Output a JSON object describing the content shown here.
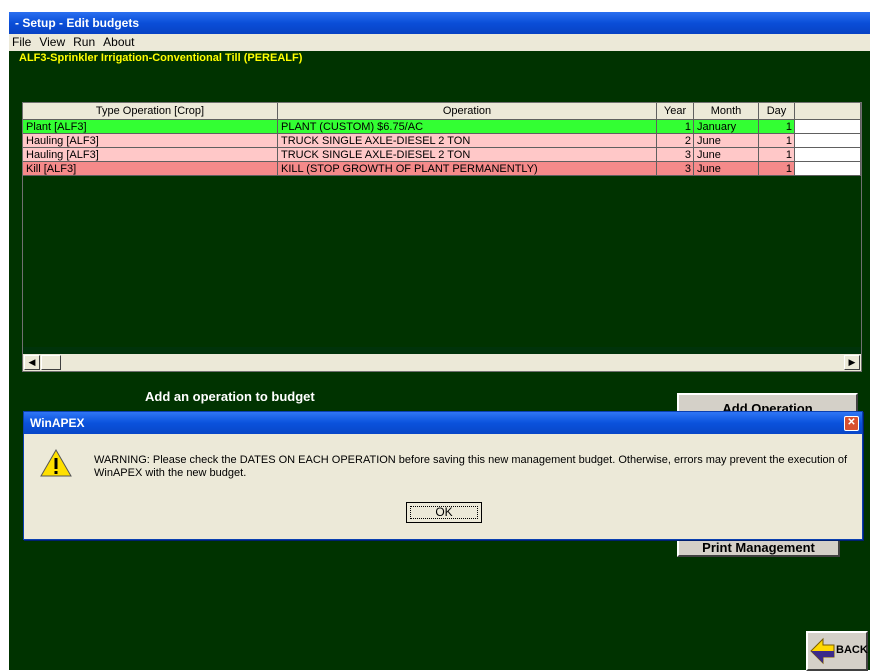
{
  "window": {
    "title": "- Setup - Edit budgets"
  },
  "menu": [
    "File",
    "View",
    "Run",
    "About"
  ],
  "subtitle": "ALF3-Sprinkler Irrigation-Conventional Till  (PEREALF)",
  "table": {
    "columns": [
      "Type Operation [Crop]",
      "Operation",
      "Year",
      "Month",
      "Day"
    ],
    "rows": [
      {
        "type": "Plant [ALF3]",
        "operation": "PLANT (CUSTOM) $6.75/AC",
        "year": "1",
        "month": "January",
        "day": "1",
        "color": "#33ff33"
      },
      {
        "type": "Hauling [ALF3]",
        "operation": "TRUCK SINGLE AXLE-DIESEL 2 TON",
        "year": "2",
        "month": "June",
        "day": "1",
        "color": "#ffc8c8"
      },
      {
        "type": "Hauling [ALF3]",
        "operation": "TRUCK SINGLE AXLE-DIESEL 2 TON",
        "year": "3",
        "month": "June",
        "day": "1",
        "color": "#ffc8c8"
      },
      {
        "type": "Kill [ALF3]",
        "operation": "KILL (STOP GROWTH OF PLANT PERMANENTLY)",
        "year": "3",
        "month": "June",
        "day": "1",
        "color": "#f58a8a"
      }
    ]
  },
  "add_label": "Add an operation to budget",
  "buttons": {
    "add_operation": "Add  Operation",
    "print_management": "Print Management",
    "back": "BACK"
  },
  "dialog": {
    "title": "WinAPEX",
    "message": "WARNING: Please check the DATES ON EACH OPERATION before saving this new management budget. Otherwise, errors may prevent the execution of WinAPEX with the new budget.",
    "ok": "OK"
  },
  "icons": [
    "warning-icon",
    "close-icon",
    "back-arrow-icon",
    "scroll-left-icon",
    "scroll-right-icon"
  ]
}
